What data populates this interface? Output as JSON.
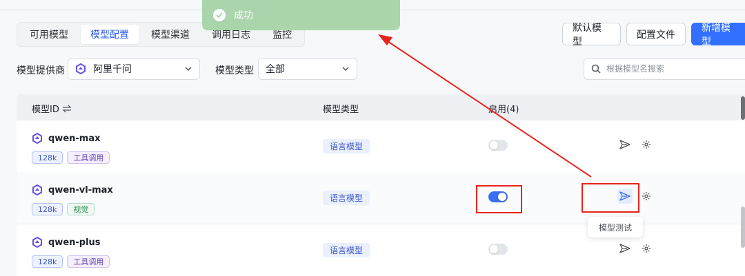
{
  "tabs": [
    {
      "label": "可用模型",
      "active": false
    },
    {
      "label": "模型配置",
      "active": true
    },
    {
      "label": "模型渠道",
      "active": false
    },
    {
      "label": "调用日志",
      "active": false
    },
    {
      "label": "监控",
      "active": false
    }
  ],
  "actions": {
    "default_model": "默认模型",
    "config_file": "配置文件",
    "add_model": "新增模型"
  },
  "filters": {
    "provider_label": "模型提供商",
    "provider_value": "阿里千问",
    "type_label": "模型类型",
    "type_value": "全部",
    "search_placeholder": "根据模型名搜索"
  },
  "table": {
    "headers": {
      "model_id": "模型ID",
      "model_type": "模型类型",
      "enabled": "启用(4)"
    },
    "rows": [
      {
        "name": "qwen-max",
        "tags": [
          "128k",
          "工具调用"
        ],
        "type": "语言模型",
        "enabled": false
      },
      {
        "name": "qwen-vl-max",
        "tags": [
          "128k",
          "视觉"
        ],
        "type": "语言模型",
        "enabled": true
      },
      {
        "name": "qwen-plus",
        "tags": [
          "128k",
          "工具调用"
        ],
        "type": "语言模型",
        "enabled": false
      }
    ]
  },
  "tooltip": "模型测试",
  "toast": {
    "message": "成功"
  },
  "icons": {
    "provider": "qwen-logo-icon",
    "send": "send-icon",
    "settings": "gear-icon",
    "sort": "swap-icon",
    "search": "search-icon",
    "toast": "check-circle-icon"
  },
  "colors": {
    "primary": "#3370ff",
    "annotation": "#e8231b",
    "toast_bg": "#a6d4a8"
  }
}
